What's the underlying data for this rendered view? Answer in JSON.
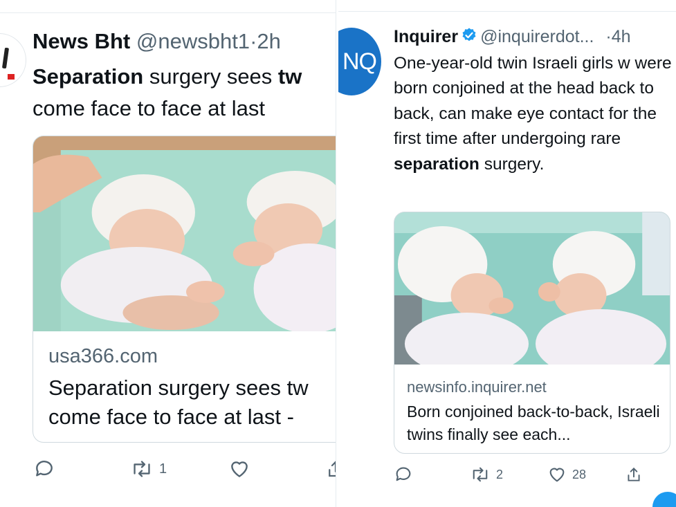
{
  "left_tweet": {
    "author_name": "News Bht",
    "handle": "@newsbht1",
    "separator": "·",
    "time": "2h",
    "text_bold1": "Separation",
    "text_mid": " surgery sees ",
    "text_bold2": "tw",
    "text_line2": "come face to face at last",
    "card": {
      "domain": "usa366.com",
      "title_line1": "Separation surgery sees tw",
      "title_line2": "come face to face at last -"
    },
    "actions": {
      "reply_count": "",
      "retweet_count": "1",
      "like_count": ""
    }
  },
  "right_tweet": {
    "avatar_text": "NQ",
    "author_name": "Inquirer",
    "handle": "@inquirerdot...",
    "separator": "·",
    "time": "4h",
    "text_before": "One-year-old twin Israeli girls w were born conjoined at the head back to back, can make eye contact for the first time after undergoing rare ",
    "text_bold": "separation",
    "text_after": " surgery.",
    "card": {
      "domain": "newsinfo.inquirer.net",
      "title": "Born conjoined back-to-back, Israeli twins finally see each..."
    },
    "actions": {
      "reply_count": "",
      "retweet_count": "2",
      "like_count": "28"
    }
  },
  "colors": {
    "text": "#0f1419",
    "secondary": "#536471",
    "verified": "#1d9bf0",
    "inquirer_avatar": "#1a73c7",
    "border": "#cfd9de"
  },
  "icons": [
    "reply-icon",
    "retweet-icon",
    "like-icon",
    "share-icon",
    "verified-icon"
  ]
}
